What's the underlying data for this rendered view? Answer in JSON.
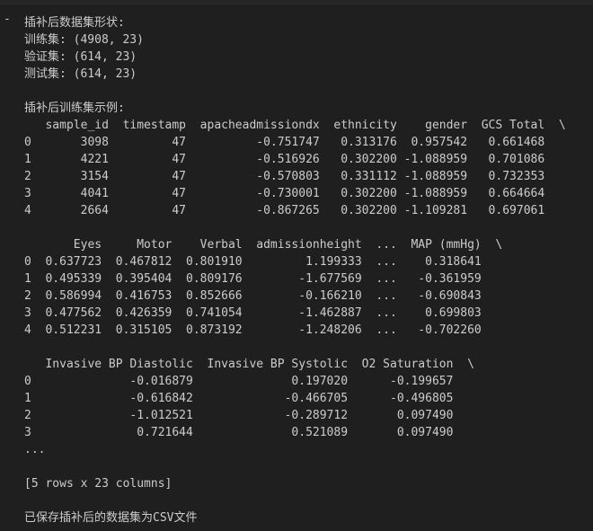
{
  "output": {
    "lines": [
      "插补后数据集形状:",
      "训练集: (4908, 23)",
      "验证集: (614, 23)",
      "测试集: (614, 23)",
      "",
      "插补后训练集示例:",
      "   sample_id  timestamp  apacheadmissiondx  ethnicity    gender  GCS Total  \\",
      "0       3098         47          -0.751747   0.313176  0.957542   0.661468",
      "1       4221         47          -0.516926   0.302200 -1.088959   0.701086",
      "2       3154         47          -0.570803   0.331112 -1.088959   0.732353",
      "3       4041         47          -0.730001   0.302200 -1.088959   0.664664",
      "4       2664         47          -0.867265   0.302200 -1.109281   0.697061",
      "",
      "       Eyes     Motor    Verbal  admissionheight  ...  MAP (mmHg)  \\",
      "0  0.637723  0.467812  0.801910         1.199333  ...    0.318641",
      "1  0.495339  0.395404  0.809176        -1.677569  ...   -0.361959",
      "2  0.586994  0.416753  0.852666        -0.166210  ...   -0.690843",
      "3  0.477562  0.426359  0.741054        -1.462887  ...    0.699803",
      "4  0.512231  0.315105  0.873192        -1.248206  ...   -0.702260",
      "",
      "   Invasive BP Diastolic  Invasive BP Systolic  O2 Saturation  \\",
      "0              -0.016879              0.197020      -0.199657",
      "1              -0.616842             -0.466705      -0.496805",
      "2              -1.012521             -0.289712       0.097490",
      "3               0.721644              0.521089       0.097490",
      "...",
      "",
      "[5 rows x 23 columns]",
      "",
      "已保存插补后的数据集为CSV文件"
    ]
  }
}
